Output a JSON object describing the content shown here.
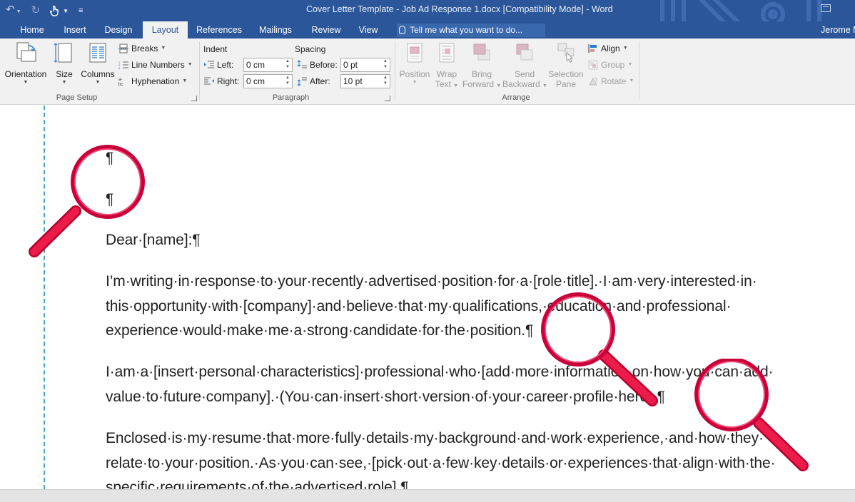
{
  "window": {
    "title": "Cover Letter Template - Job Ad Response 1.docx [Compatibility Mode] - Word"
  },
  "quick_access": {
    "undo_icon": "undo-icon",
    "redo_icon": "redo-icon",
    "touch_icon": "touch-mode-icon",
    "customize_icon": "customize-qat-icon"
  },
  "tabs": [
    {
      "label": "Home"
    },
    {
      "label": "Insert"
    },
    {
      "label": "Design"
    },
    {
      "label": "Layout",
      "active": true
    },
    {
      "label": "References"
    },
    {
      "label": "Mailings"
    },
    {
      "label": "Review"
    },
    {
      "label": "View"
    }
  ],
  "tell_me": {
    "placeholder": "Tell me what you want to do..."
  },
  "user": {
    "name": "Jerome M"
  },
  "ribbon": {
    "page_setup": {
      "label": "Page Setup",
      "orientation": "Orientation",
      "size": "Size",
      "columns": "Columns",
      "breaks": "Breaks",
      "line_numbers": "Line Numbers",
      "hyphenation": "Hyphenation"
    },
    "paragraph": {
      "label": "Paragraph",
      "indent_label": "Indent",
      "spacing_label": "Spacing",
      "left_label": "Left:",
      "right_label": "Right:",
      "before_label": "Before:",
      "after_label": "After:",
      "left_value": "0 cm",
      "right_value": "0 cm",
      "before_value": "0 pt",
      "after_value": "10 pt"
    },
    "arrange": {
      "label": "Arrange",
      "position": [
        "Position",
        ""
      ],
      "wrap_text": [
        "Wrap",
        "Text"
      ],
      "bring_forward": [
        "Bring",
        "Forward"
      ],
      "send_backward": [
        "Send",
        "Backward"
      ],
      "selection_pane": [
        "Selection",
        "Pane"
      ],
      "align": "Align",
      "group": "Group",
      "rotate": "Rotate"
    }
  },
  "document": {
    "para_mark": "¶",
    "salutation": "Dear·[name]:¶",
    "p1": [
      "I’m·writing·in·response·to·your·recently·advertised·position·for·a·[role·title].·I·am·very·interested·in·",
      "this·opportunity·with·[company]·and·believe·that·my·qualifications,·education·and·professional·",
      "experience·would·make·me·a·strong·candidate·for·the·position.¶"
    ],
    "p2": [
      "I·am·a·[insert·personal·characteristics]·professional·who·[add·more·information·on·how·you·can·add·",
      "value·to·future·company].·(You·can·insert·short·version·of·your·career·profile·here).¶"
    ],
    "p3": [
      "Enclosed·is·my·resume·that·more·fully·details·my·background·and·work·experience,·and·how·they·",
      "relate·to·your·position.·As·you·can·see,·[pick·out·a·few·key·details·or·experiences·that·align·with·the·",
      "specific·requirements·of·the·advertised·role].¶"
    ]
  },
  "colors": {
    "accent": "#2b579a",
    "ribbon_bg": "#f1f1f1",
    "margin_guide": "#4aa6c8",
    "magnifier": "#e4003a"
  }
}
